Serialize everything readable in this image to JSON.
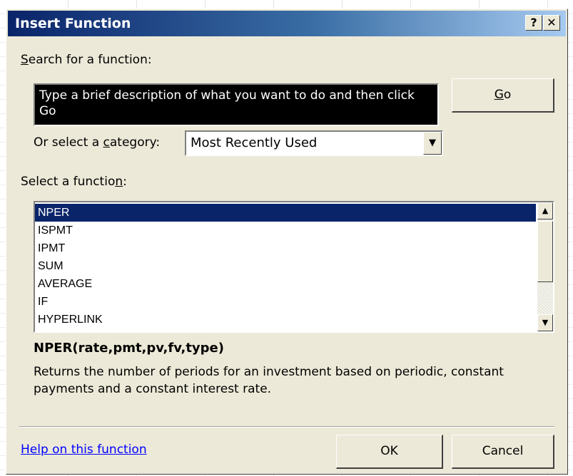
{
  "dialog": {
    "title": "Insert Function",
    "help_button": "?",
    "close_button": "✕"
  },
  "search": {
    "label_pre": "",
    "label_accel": "S",
    "label_post": "earch for a function:",
    "value": "Type a brief description of what you want to do and then click Go",
    "go_pre": "",
    "go_accel": "G",
    "go_post": "o"
  },
  "category": {
    "label_pre": "Or select a ",
    "label_accel": "c",
    "label_post": "ategory:",
    "selected": "Most Recently Used",
    "arrow": "▼"
  },
  "function_list": {
    "label_pre": "Select a functio",
    "label_accel": "n",
    "label_post": ":",
    "items": [
      "NPER",
      "ISPMT",
      "IPMT",
      "SUM",
      "AVERAGE",
      "IF",
      "HYPERLINK"
    ],
    "selected": "NPER",
    "scroll_up": "▲",
    "scroll_down": "▼"
  },
  "details": {
    "signature": "NPER(rate,pmt,pv,fv,type)",
    "description": "Returns the number of periods for an investment based on periodic, constant payments and a constant interest rate."
  },
  "footer": {
    "help_link": "Help on this function",
    "ok_label": "OK",
    "cancel_label": "Cancel"
  }
}
